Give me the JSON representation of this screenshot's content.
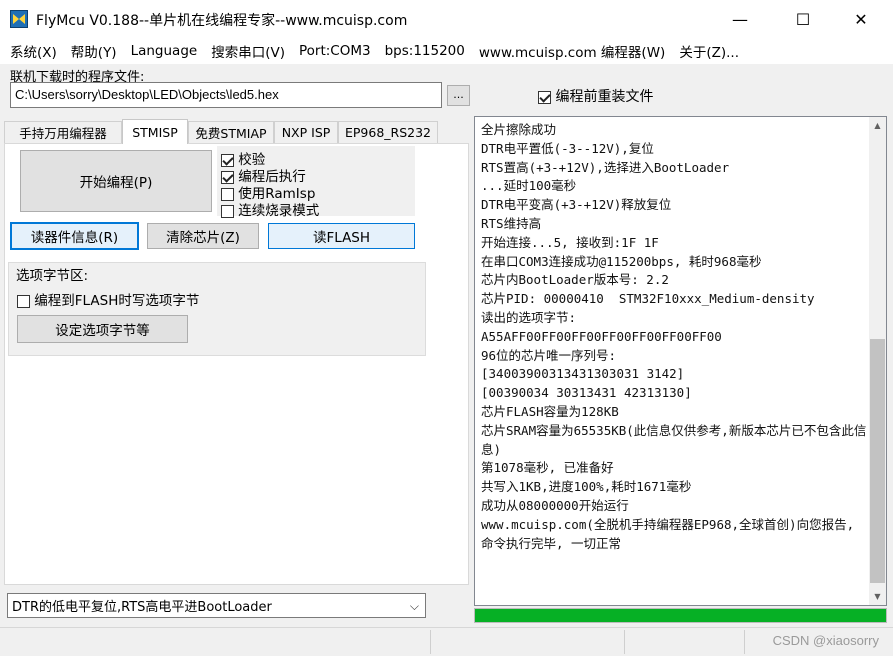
{
  "window": {
    "title": "FlyMcu V0.188--单片机在线编程专家--www.mcuisp.com",
    "minimize": "—",
    "maximize": "☐",
    "close": "✕",
    "icon": "flymcu-app-icon"
  },
  "menu": [
    "系统(X)",
    "帮助(Y)",
    "Language",
    "搜索串口(V)",
    "Port:COM3",
    "bps:115200",
    "www.mcuisp.com 编程器(W)",
    "关于(Z)..."
  ],
  "file": {
    "label": "联机下载时的程序文件:",
    "path": "C:\\Users\\sorry\\Desktop\\LED\\Objects\\led5.hex",
    "browse": "...",
    "reload_label": "编程前重装文件",
    "reload_checked": true
  },
  "tabs": [
    "手持万用编程器",
    "STMISP",
    "免费STMIAP",
    "NXP ISP",
    "EP968_RS232"
  ],
  "stmisp": {
    "start_button": "开始编程(P)",
    "options": [
      {
        "label": "校验",
        "checked": true
      },
      {
        "label": "编程后执行",
        "checked": true
      },
      {
        "label": "使用RamIsp",
        "checked": false
      },
      {
        "label": "连续烧录模式",
        "checked": false
      }
    ],
    "read_info_button": "读器件信息(R)",
    "erase_button": "清除芯片(Z)",
    "read_flash_button": "读FLASH",
    "option_group_title": "选项字节区:",
    "option_write_label": "编程到FLASH时写选项字节",
    "option_write_checked": false,
    "option_set_button": "设定选项字节等"
  },
  "reset_mode": {
    "selected": "DTR的低电平复位,RTS高电平进BootLoader",
    "arrow": "⌵"
  },
  "log_lines": [
    "全片擦除成功",
    "DTR电平置低(-3--12V),复位",
    "RTS置高(+3-+12V),选择进入BootLoader",
    "...延时100毫秒",
    "DTR电平变高(+3-+12V)释放复位",
    "RTS维持高",
    "开始连接...5, 接收到:1F 1F",
    "在串口COM3连接成功@115200bps, 耗时968毫秒",
    "芯片内BootLoader版本号: 2.2",
    "芯片PID: 00000410  STM32F10xxx_Medium-density",
    "读出的选项字节:",
    "A55AFF00FF00FF00FF00FF00FF00FF00",
    "96位的芯片唯一序列号:",
    "[34003900313431303031 3142]",
    "[00390034 30313431 42313130]",
    "芯片FLASH容量为128KB",
    "芯片SRAM容量为65535KB(此信息仅供参考,新版本芯片已不包含此信息)",
    "第1078毫秒, 已准备好",
    "共写入1KB,进度100%,耗时1671毫秒",
    "成功从08000000开始运行",
    "www.mcuisp.com(全脱机手持编程器EP968,全球首创)向您报告, 命令执行完毕, 一切正常"
  ],
  "progress_percent": 100,
  "watermark": "CSDN @xiaosorry",
  "colors": {
    "progress": "#06b025",
    "focus": "#0078d7"
  }
}
